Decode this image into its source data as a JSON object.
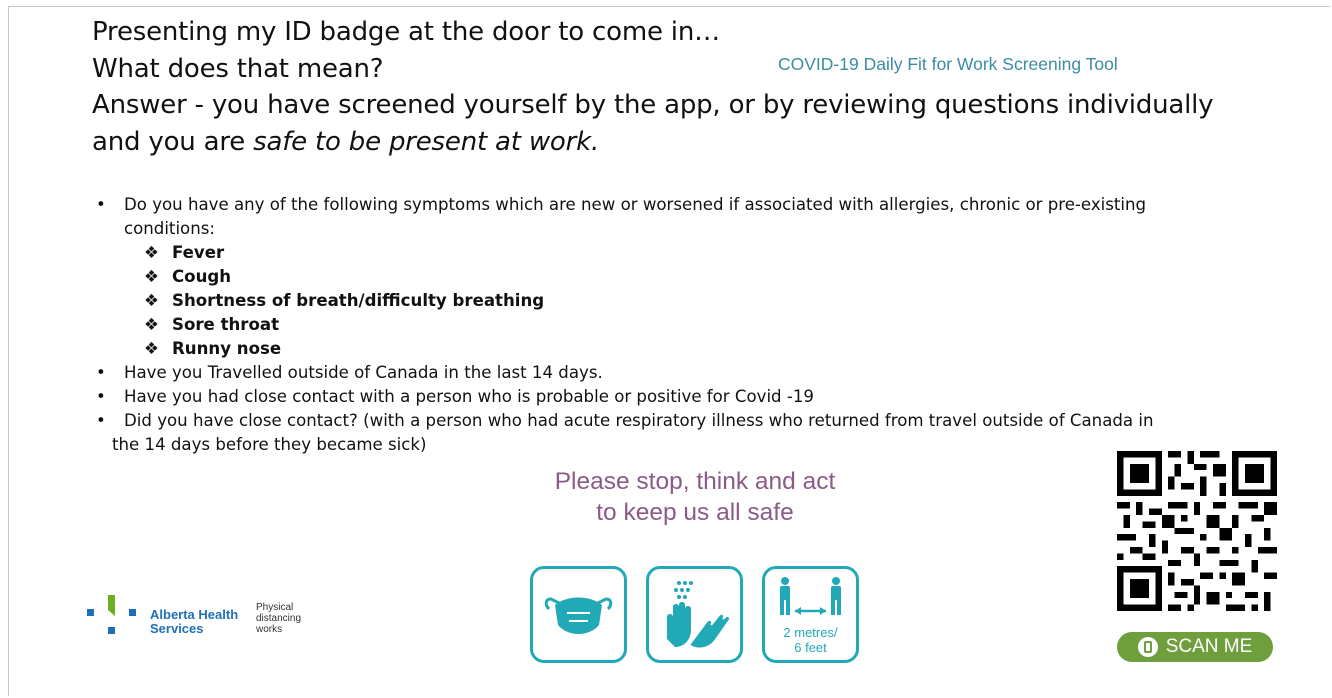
{
  "heading": {
    "line1": "Presenting my ID badge at the door to come in…",
    "line2": "What does that mean?",
    "line3": "Answer - you have screened yourself by the app, or by reviewing questions individually",
    "line4_plain": "and you are ",
    "line4_italic": "safe to be present at work."
  },
  "tool_title": "COVID-19 Daily Fit for Work Screening Tool",
  "questions": {
    "bullet": "•",
    "diamond": "❖",
    "q1": "Do you have any of the following symptoms which are new or worsened if associated with allergies, chronic or pre-existing",
    "q1_cont": "conditions:",
    "symptoms": [
      "Fever",
      "Cough",
      "Shortness of breath/difficulty  breathing",
      "Sore throat",
      "Runny nose"
    ],
    "q2": "Have you Travelled outside of Canada in the last 14 days.",
    "q3": "Have you had close contact with a person who is probable or positive for Covid -19",
    "q4": "Did you have close contact? (with a person who had acute respiratory illness who returned from travel outside of Canada in",
    "q4_cont": "the 14 days before they became sick)"
  },
  "slogan": {
    "line1": "Please stop, think and act",
    "line2": "to keep us all safe"
  },
  "icons": {
    "mask": "face-mask-icon",
    "handwash": "hand-washing-icon",
    "distance": "physical-distance-icon",
    "distance_line1": "2 metres/",
    "distance_line2": "6 feet",
    "accent": "#21a9b7"
  },
  "org": {
    "name_line1": "Alberta Health",
    "name_line2": "Services",
    "tag_line1": "Physical",
    "tag_line2": "distancing",
    "tag_line3": "works",
    "brand_blue": "#1f6fb8",
    "brand_green": "#6ab023"
  },
  "qr": {
    "icon": "qr-code-icon",
    "scan_label": "SCAN ME",
    "scan_color": "#6f9e3c"
  },
  "colors": {
    "tool_title": "#3b8ea1",
    "slogan": "#8b5b87"
  }
}
